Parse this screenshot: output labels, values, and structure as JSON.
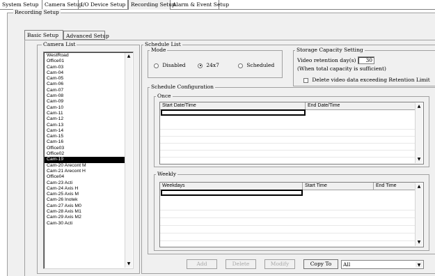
{
  "top_tabs": [
    "System Setup",
    "Camera Setup",
    "I/O Device Setup",
    "Recording Setup",
    "Alarm & Event Setup"
  ],
  "top_tab_active": "Recording Setup",
  "recording_group_title": "Recording Setup",
  "sub_tabs": [
    "Basic Setup",
    "Advanced Setup"
  ],
  "camera_list": {
    "title": "Camera List",
    "items": [
      "WestRoad",
      "Office01",
      "Cam-03",
      "Cam-04",
      "Cam-05",
      "Cam-06",
      "Cam-07",
      "Cam-08",
      "Cam-09",
      "Cam-10",
      "Cam-11",
      "Cam-12",
      "Cam-13",
      "Cam-14",
      "Cam-15",
      "Cam-16",
      "Office03",
      "Office02",
      "Cam-19",
      "Cam-20 Arecont M",
      "Cam-21 Arecont H",
      "Office04",
      "Cam-23 Acti",
      "Cam-24 Axis H",
      "Cam-25 Axis M",
      "Cam-26 Inotek",
      "Cam-27 Axis M0",
      "Cam-28 Axis M1",
      "Cam-29 Axis M2",
      "Cam-30 Acti"
    ],
    "selected": "Cam-19"
  },
  "schedule_list": {
    "title": "Schedule List",
    "mode": {
      "title": "Mode",
      "options": [
        "Disabled",
        "24x7",
        "Scheduled"
      ],
      "selected": "24x7"
    },
    "storage": {
      "title": "Storage Capacity Setting",
      "retention_label": "Video retention day(s) :",
      "retention_value": "30",
      "retention_note": "(When total capacity is sufficient)",
      "delete_label": "Delete video data exceeding Retention Limit",
      "delete_checked": false
    },
    "config": {
      "title": "Schedule Configuration",
      "once": {
        "title": "Once",
        "columns": [
          "Start Date/Time",
          "End Date/Time"
        ]
      },
      "weekly": {
        "title": "Weekly",
        "columns": [
          "Weekdays",
          "Start Time",
          "End Time"
        ]
      }
    }
  },
  "buttons": {
    "add": "Add",
    "delete": "Delete",
    "modify": "Modify",
    "copy_to": "Copy To"
  },
  "copy_to_select": "All"
}
